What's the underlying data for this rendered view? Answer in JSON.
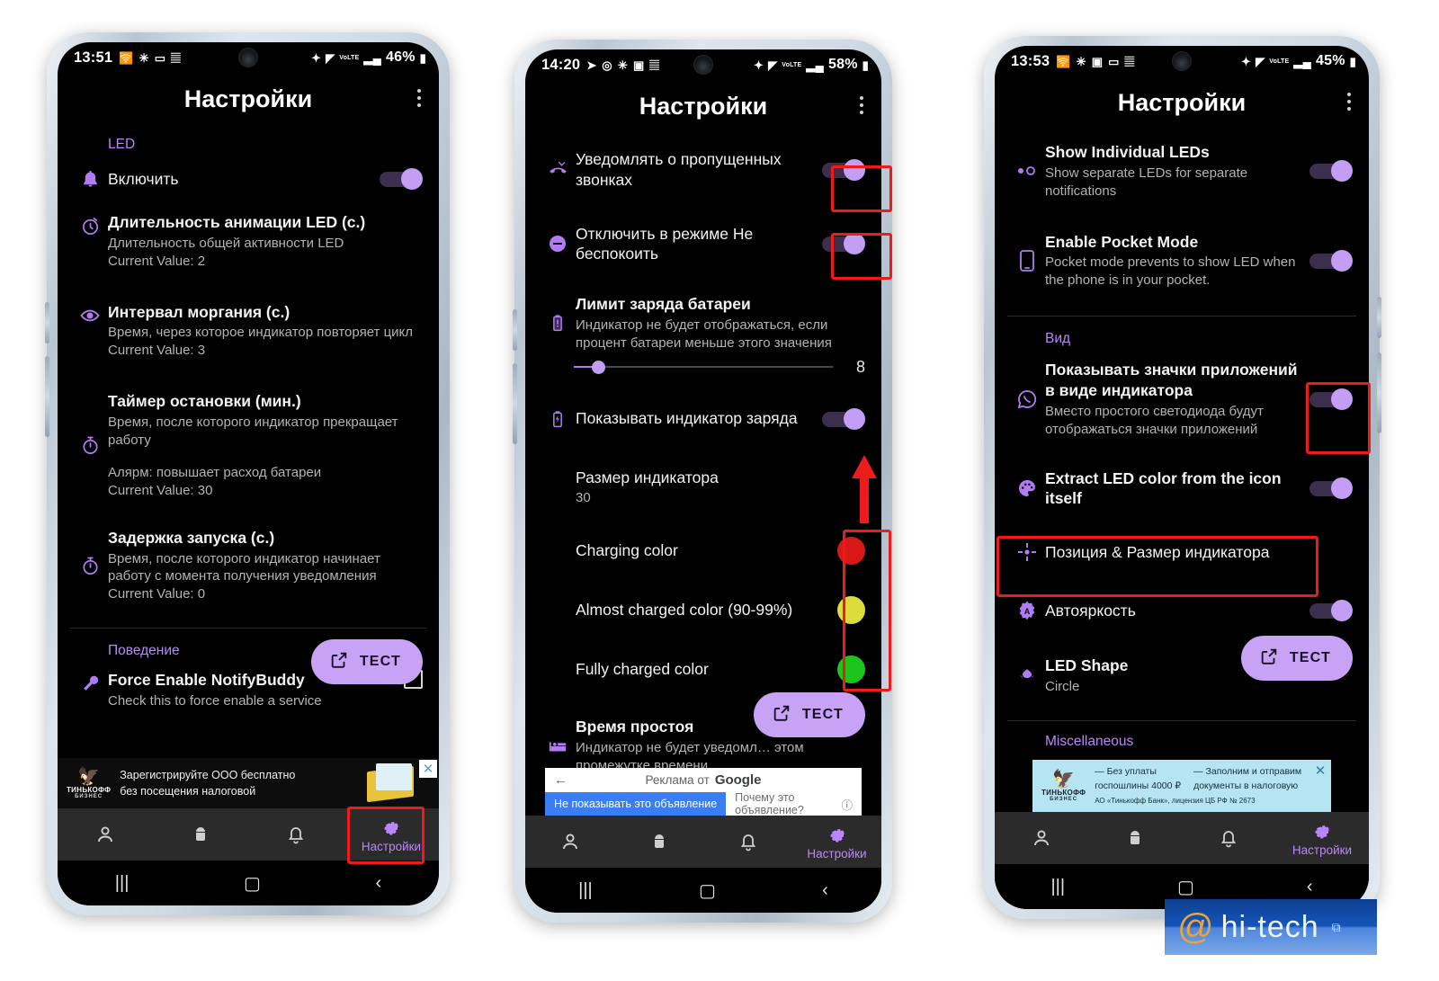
{
  "page": {
    "background": "#ffffff",
    "accent_purple": "#bb86fc",
    "toggle_on_color": "#c49df5",
    "annotation_color": "#ee1b1b"
  },
  "watermark": {
    "at": "@",
    "text": "hi-tech",
    "badge": "⧉"
  },
  "phones": [
    {
      "id": "phone-1",
      "status_bar": {
        "time": "13:51",
        "left_icons": [
          "cast-icon",
          "snowflake-icon",
          "screen-icon",
          "music-icon"
        ],
        "right_icons": [
          "bluetooth-icon",
          "wifi-icon",
          "volte-icon",
          "signal-icon"
        ],
        "volte_label": "VoLTE",
        "battery": "46%"
      },
      "header": {
        "title": "Настройки",
        "menu": "overflow-menu-icon"
      },
      "sections": [
        {
          "label": "LED",
          "rows": [
            {
              "icon": "bell-icon",
              "title": "Включить",
              "sub": "",
              "value": "",
              "control": "toggle",
              "toggle_on": true
            },
            {
              "icon": "timer-animation-icon",
              "title": "Длительность анимации LED (c.)",
              "sub": "Длительность общей активности LED",
              "value": "Current Value: 2",
              "control": "none"
            },
            {
              "icon": "eye-icon",
              "title": "Интервал моргания (c.)",
              "sub": "Время, через которое индикатор повторяет цикл",
              "value": "Current Value: 3",
              "control": "none"
            },
            {
              "icon": "stopwatch-icon",
              "title": "Таймер остановки (мин.)",
              "sub": "Время, после которого индикатор прекращает работу",
              "value2": "Алярм: повышает расход батареи",
              "value": "Current Value: 30",
              "control": "none"
            },
            {
              "icon": "stopwatch-icon",
              "title": "Задержка запуска (c.)",
              "sub": "Время, после которого индикатор начинает работу с момента получения уведомления",
              "value": "Current Value: 0",
              "control": "none"
            }
          ]
        },
        {
          "label": "Поведение",
          "rows": [
            {
              "icon": "wrench-icon",
              "title": "Force Enable NotifyBuddy",
              "sub": "Check this to force enable a service",
              "value": "",
              "control": "checkbox"
            }
          ]
        }
      ],
      "fab": {
        "label": "ТЕСТ",
        "icon": "external-link-icon"
      },
      "ad": {
        "type": "tinkoff",
        "brand": "ТИНЬКОФФ",
        "brand_sub": "БИЗНЕС",
        "line1": "Зарегистрируйте ООО бесплатно",
        "line2": "без посещения налоговой",
        "close": "✕"
      },
      "bottom_nav": [
        {
          "icon": "person-icon",
          "label": "",
          "active": false
        },
        {
          "icon": "android-icon",
          "label": "",
          "active": false
        },
        {
          "icon": "bell-icon",
          "label": "",
          "active": false
        },
        {
          "icon": "gear-icon",
          "label": "Настройки",
          "active": true
        }
      ],
      "system_nav": [
        "recents-button",
        "home-button",
        "back-button"
      ],
      "annotations": [
        {
          "name": "settings-tab-highlight",
          "target": "bottom-nav-settings"
        }
      ]
    },
    {
      "id": "phone-2",
      "status_bar": {
        "time": "14:20",
        "left_icons": [
          "telegram-icon",
          "instagram-icon",
          "snowflake-icon",
          "photos-icon",
          "music-icon"
        ],
        "right_icons": [
          "bluetooth-icon",
          "wifi-icon",
          "volte-icon",
          "signal-icon"
        ],
        "volte_label": "VoLTE",
        "battery": "58%"
      },
      "header": {
        "title": "Настройки",
        "menu": "overflow-menu-icon"
      },
      "sections": [
        {
          "label": "",
          "rows": [
            {
              "icon": "missed-call-icon",
              "title": "Уведомлять о пропущенных звонках",
              "sub": "",
              "control": "toggle",
              "toggle_on": true,
              "highlighted": true
            },
            {
              "icon": "do-not-disturb-icon",
              "title": "Отключить в режиме Не беспокоить",
              "sub": "",
              "control": "toggle",
              "toggle_on": true,
              "highlighted": true
            },
            {
              "icon": "battery-alert-icon",
              "title": "Лимит заряда батареи",
              "sub": "Индикатор не будет отображаться, если процент батареи меньше этого значения",
              "control": "slider",
              "slider_value": "8",
              "slider_pct": 8
            },
            {
              "icon": "battery-charging-icon",
              "title": "Показывать индикатор заряда",
              "sub": "",
              "control": "toggle",
              "toggle_on": true,
              "arrow": true
            },
            {
              "icon": "",
              "title": "Размер индикатора",
              "sub": "30",
              "control": "none"
            },
            {
              "icon": "",
              "title": "Charging color",
              "sub": "",
              "control": "color",
              "color": "#d91717"
            },
            {
              "icon": "",
              "title": "Almost charged color (90-99%)",
              "sub": "",
              "control": "color",
              "color": "#dcdc3c"
            },
            {
              "icon": "",
              "title": "Fully charged color",
              "sub": "",
              "control": "color",
              "color": "#1cc41c"
            },
            {
              "icon": "bed-icon",
              "title": "Время простоя",
              "sub": "Индикатор не будет уведомл… этом промежутке времени",
              "control": "none"
            }
          ]
        }
      ],
      "fab": {
        "label": "ТЕСТ",
        "icon": "external-link-icon"
      },
      "ad": {
        "type": "google",
        "back": "←",
        "label": "Реклама от",
        "logo": "Google",
        "btn_primary": "Не показывать это объявление",
        "btn_secondary": "Почему это объявление?",
        "info": "ⓘ"
      },
      "bottom_nav": [
        {
          "icon": "person-icon",
          "label": "",
          "active": false
        },
        {
          "icon": "android-icon",
          "label": "",
          "active": false
        },
        {
          "icon": "bell-icon",
          "label": "",
          "active": false
        },
        {
          "icon": "gear-icon",
          "label": "Настройки",
          "active": true
        }
      ],
      "system_nav": [
        "recents-button",
        "home-button",
        "back-button"
      ],
      "annotations": [
        {
          "name": "missed-calls-toggle-highlight"
        },
        {
          "name": "dnd-toggle-highlight"
        },
        {
          "name": "charge-indicator-arrow"
        },
        {
          "name": "charge-colors-highlight"
        }
      ]
    },
    {
      "id": "phone-3",
      "status_bar": {
        "time": "13:53",
        "left_icons": [
          "cast-icon",
          "snowflake-icon",
          "photos-icon",
          "screen-icon",
          "music-icon"
        ],
        "right_icons": [
          "bluetooth-icon",
          "wifi-icon",
          "volte-icon",
          "signal-icon"
        ],
        "volte_label": "VoLTE",
        "battery": "45%"
      },
      "header": {
        "title": "Настройки",
        "menu": "overflow-menu-icon"
      },
      "sections": [
        {
          "label": "",
          "rows": [
            {
              "icon": "two-dots-icon",
              "title": "Show Individual LEDs",
              "sub": "Show separate LEDs for separate notifications",
              "control": "toggle",
              "toggle_on": true
            },
            {
              "icon": "phone-icon",
              "title": "Enable Pocket Mode",
              "sub": "Pocket mode prevents to show LED when the phone is in your pocket.",
              "control": "toggle",
              "toggle_on": true
            }
          ]
        },
        {
          "label": "Вид",
          "rows": [
            {
              "icon": "whatsapp-icon",
              "title": "Показывать значки приложений в виде индикатора",
              "sub": "Вместо простого светодиода будут отображаться значки приложений",
              "control": "toggle",
              "toggle_on": true,
              "highlighted": true
            },
            {
              "icon": "palette-icon",
              "title": "Extract LED color from the icon itself",
              "sub": "",
              "control": "toggle",
              "toggle_on": true
            },
            {
              "icon": "move-resize-icon",
              "title": "Позиция & Размер индикатора",
              "sub": "",
              "control": "none",
              "highlighted": true
            },
            {
              "icon": "auto-brightness-icon",
              "title": "Автояркость",
              "sub": "",
              "control": "toggle",
              "toggle_on": true
            },
            {
              "icon": "shape-icon",
              "title": "LED Shape",
              "sub": "Circle",
              "control": "none"
            }
          ]
        },
        {
          "label": "Miscellaneous",
          "rows": []
        }
      ],
      "fab": {
        "label": "ТЕСТ",
        "icon": "external-link-icon"
      },
      "ad": {
        "type": "tinkoff-cyan",
        "brand": "ТИНЬКОФФ",
        "brand_sub": "БИЗНЕС",
        "col1_line1": "— Без уплаты",
        "col1_line2": "госпошлины 4000 ₽",
        "col2_line1": "— Заполним и отправим",
        "col2_line2": "документы в налоговую",
        "legal": "АО «Тинькофф Банк», лицензия ЦБ РФ № 2673",
        "close": "✕"
      },
      "bottom_nav": [
        {
          "icon": "person-icon",
          "label": "",
          "active": false
        },
        {
          "icon": "android-icon",
          "label": "",
          "active": false
        },
        {
          "icon": "bell-icon",
          "label": "",
          "active": false
        },
        {
          "icon": "gear-icon",
          "label": "Настройки",
          "active": true
        }
      ],
      "system_nav": [
        "recents-button",
        "home-button",
        "back-button"
      ],
      "annotations": [
        {
          "name": "app-icon-indicator-toggle-highlight"
        },
        {
          "name": "position-size-row-highlight"
        }
      ]
    }
  ]
}
